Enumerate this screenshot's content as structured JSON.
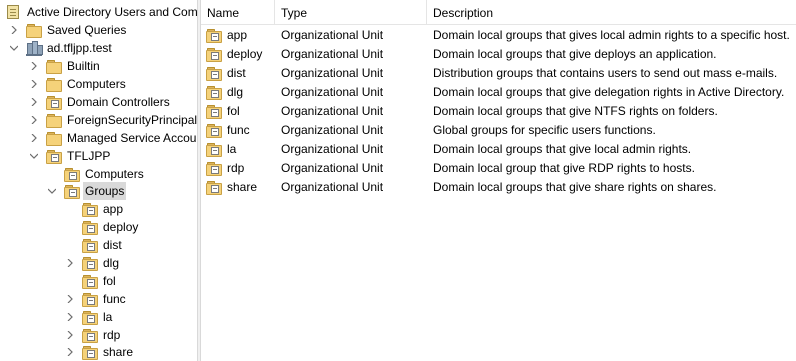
{
  "tree": {
    "root_label": "Active Directory Users and Com",
    "saved_queries": "Saved Queries",
    "domain": "ad.tfljpp.test",
    "containers": [
      {
        "label": "Builtin"
      },
      {
        "label": "Computers"
      },
      {
        "label": "Domain Controllers"
      },
      {
        "label": "ForeignSecurityPrincipals"
      },
      {
        "label": "Managed Service Accour"
      },
      {
        "label": "TFLJPP"
      }
    ],
    "tfljpp_children": [
      {
        "label": "Computers"
      },
      {
        "label": "Groups"
      }
    ],
    "groups_children": [
      {
        "label": "app"
      },
      {
        "label": "deploy"
      },
      {
        "label": "dist"
      },
      {
        "label": "dlg"
      },
      {
        "label": "fol"
      },
      {
        "label": "func"
      },
      {
        "label": "la"
      },
      {
        "label": "rdp"
      },
      {
        "label": "share"
      }
    ]
  },
  "list": {
    "columns": {
      "name": "Name",
      "type": "Type",
      "description": "Description"
    },
    "rows": [
      {
        "name": "app",
        "type": "Organizational Unit",
        "description": "Domain local groups that gives local admin rights to a specific host."
      },
      {
        "name": "deploy",
        "type": "Organizational Unit",
        "description": "Domain local groups that give deploys an application."
      },
      {
        "name": "dist",
        "type": "Organizational Unit",
        "description": "Distribution groups that contains users to send out mass e-mails."
      },
      {
        "name": "dlg",
        "type": "Organizational Unit",
        "description": "Domain local groups that give delegation rights in Active Directory."
      },
      {
        "name": "fol",
        "type": "Organizational Unit",
        "description": "Domain local groups that give NTFS rights on folders."
      },
      {
        "name": "func",
        "type": "Organizational Unit",
        "description": "Global groups for specific users functions."
      },
      {
        "name": "la",
        "type": "Organizational Unit",
        "description": "Domain local groups that give local admin rights."
      },
      {
        "name": "rdp",
        "type": "Organizational Unit",
        "description": "Domain local group that give RDP rights to hosts."
      },
      {
        "name": "share",
        "type": "Organizational Unit",
        "description": "Domain local groups that give share rights on shares."
      }
    ]
  },
  "colors": {
    "selection": "#d9d9d9",
    "folder": "#f5d27a",
    "chevron": "#6d6d6d"
  }
}
